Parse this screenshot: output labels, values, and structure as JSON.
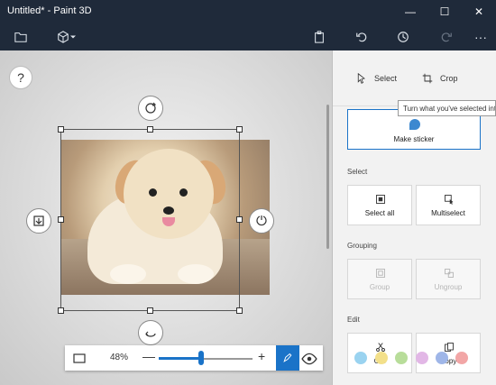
{
  "window": {
    "title": "Untitled* - Paint 3D",
    "minimize": "—",
    "maximize": "☐",
    "close": "✕"
  },
  "toolbar": {
    "icons": [
      "folder-icon",
      "cube-icon",
      "paste-icon",
      "undo-icon",
      "history-icon",
      "redo-icon",
      "more-icon"
    ],
    "more_label": "···"
  },
  "canvas": {
    "help_label": "?",
    "zoom": {
      "percent_label": "48%",
      "level": 0.48,
      "minus_label": "—",
      "plus_label": "+"
    }
  },
  "panel": {
    "tools": [
      {
        "label": "Select"
      },
      {
        "label": "Crop"
      }
    ],
    "tooltip": "Turn what you've selected into a sticker",
    "make_sticker_label": "Make sticker",
    "sections": {
      "select": "Select",
      "grouping": "Grouping",
      "edit": "Edit"
    },
    "select_buttons": [
      {
        "label": "Select all"
      },
      {
        "label": "Multiselect"
      }
    ],
    "grouping_buttons": [
      {
        "label": "Group"
      },
      {
        "label": "Ungroup"
      }
    ],
    "edit_buttons": [
      {
        "label": "Cut"
      },
      {
        "label": "Copy"
      }
    ]
  },
  "colors": {
    "accent": "#1a73c8",
    "titlebar": "#1f2a3a",
    "palette": [
      "#9ad3f0",
      "#f3e08a",
      "#b8dd9a",
      "#e2b7e6",
      "#9fb6e8",
      "#f2a6a6"
    ]
  }
}
